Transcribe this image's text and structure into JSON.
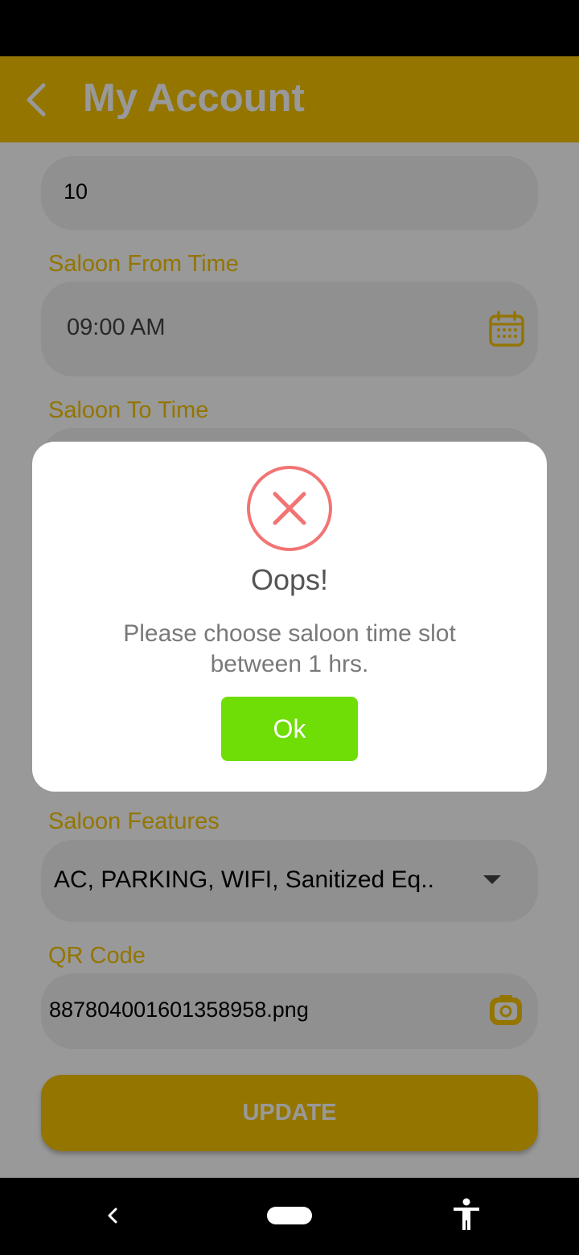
{
  "app_bar": {
    "title": "My Account"
  },
  "form": {
    "count_value": "10",
    "from_time_label": "Saloon From Time",
    "from_time_value": "09:00 AM",
    "to_time_label": "Saloon To Time",
    "features_label": "Saloon Features",
    "features_value": "AC, PARKING, WIFI, Sanitized Eq..",
    "qr_label": "QR Code",
    "qr_value": "887804001601358958.png",
    "update_label": "UPDATE"
  },
  "dialog": {
    "title": "Oops!",
    "message": "Please choose saloon time slot between 1 hrs.",
    "ok_label": "Ok"
  },
  "colors": {
    "accent": "#f5c400",
    "error": "#f27474",
    "ok_button": "#6fdd06"
  },
  "icons": [
    "back-arrow-icon",
    "calendar-icon",
    "dropdown-arrow-icon",
    "camera-icon",
    "error-x-icon",
    "nav-back-icon",
    "nav-home-icon",
    "accessibility-icon"
  ]
}
